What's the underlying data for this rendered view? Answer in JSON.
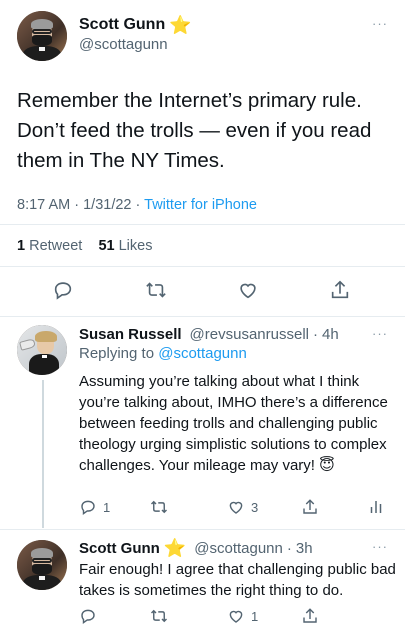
{
  "main_tweet": {
    "display_name": "Scott Gunn",
    "badge_emoji": "⭐",
    "handle": "@scottagunn",
    "text": "Remember the Internet’s primary rule. Don’t feed the trolls — even if you read them in The NY Times.",
    "time": "8:17 AM",
    "date": "1/31/22",
    "source": "Twitter for iPhone",
    "retweet_count": "1",
    "retweet_label": "Retweet",
    "like_count": "51",
    "like_label": "Likes"
  },
  "reply1": {
    "display_name": "Susan Russell",
    "handle": "@revsusanrussell",
    "time_ago": "4h",
    "replying_to_label": "Replying to",
    "replying_to_handle": "@scottagunn",
    "text": "Assuming you’re talking about what I think you’re talking about, IMHO there’s a difference between feeding trolls and challenging public theology urging simplistic solutions to complex challenges. Your mileage may vary! 😇",
    "reply_count": "1",
    "like_count": "3"
  },
  "reply2": {
    "display_name": "Scott Gunn",
    "badge_emoji": "⭐",
    "handle": "@scottagunn",
    "time_ago": "3h",
    "text": "Fair enough! I agree that challenging public bad takes is sometimes the right thing to do.",
    "like_count": "1"
  },
  "separator": "·",
  "more_glyph": "···",
  "colors": {
    "text": "#0f1419",
    "secondary": "#536471",
    "accent": "#1d9bf0",
    "divider": "#e6ecf0"
  }
}
